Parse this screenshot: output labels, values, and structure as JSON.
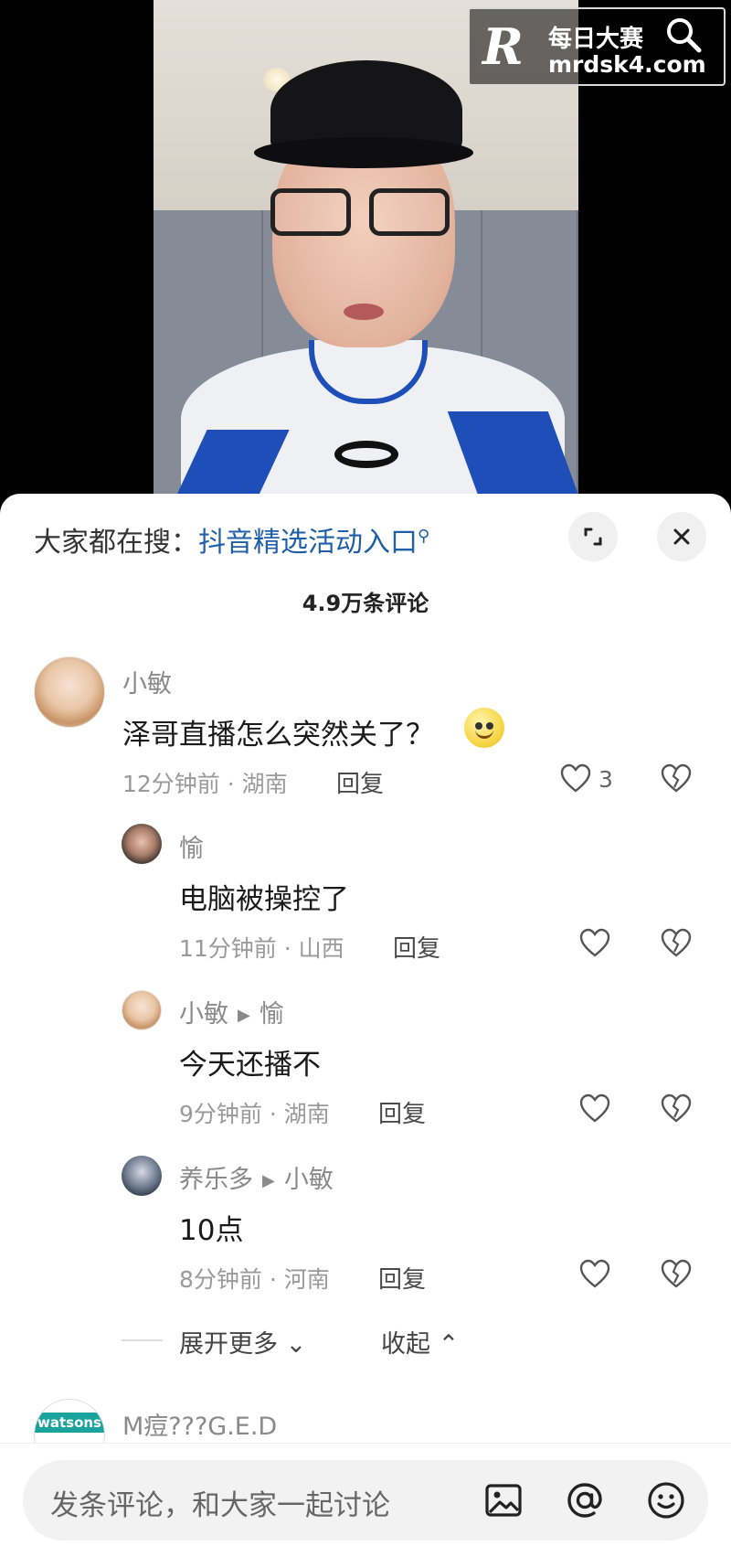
{
  "watermark": {
    "logo_letter": "R",
    "title": "每日大赛",
    "url": "mrdsk4.com"
  },
  "sheet": {
    "hot_search_prefix": "大家都在搜：",
    "hot_search_link": "抖音精选活动入口",
    "comment_count": "4.9万条评论"
  },
  "comments": [
    {
      "user": "小敏",
      "text": "泽哥直播怎么突然关了？",
      "meta": "12分钟前 · 湖南",
      "reply_label": "回复",
      "likes": "3"
    }
  ],
  "replies": [
    {
      "user": "愉",
      "to": "",
      "text": "电脑被操控了",
      "meta": "11分钟前 · 山西",
      "reply_label": "回复"
    },
    {
      "user": "小敏",
      "to": "愉",
      "text": "今天还播不",
      "meta": "9分钟前 · 湖南",
      "reply_label": "回复"
    },
    {
      "user": "养乐多",
      "to": "小敏",
      "text": "10点",
      "meta": "8分钟前 · 河南",
      "reply_label": "回复"
    }
  ],
  "thread_controls": {
    "expand_more": "展开更多",
    "collapse": "收起"
  },
  "next_comment": {
    "user": "M痘???G.E.D",
    "avatar_text": "watsons"
  },
  "input_bar": {
    "placeholder": "发条评论，和大家一起讨论"
  }
}
